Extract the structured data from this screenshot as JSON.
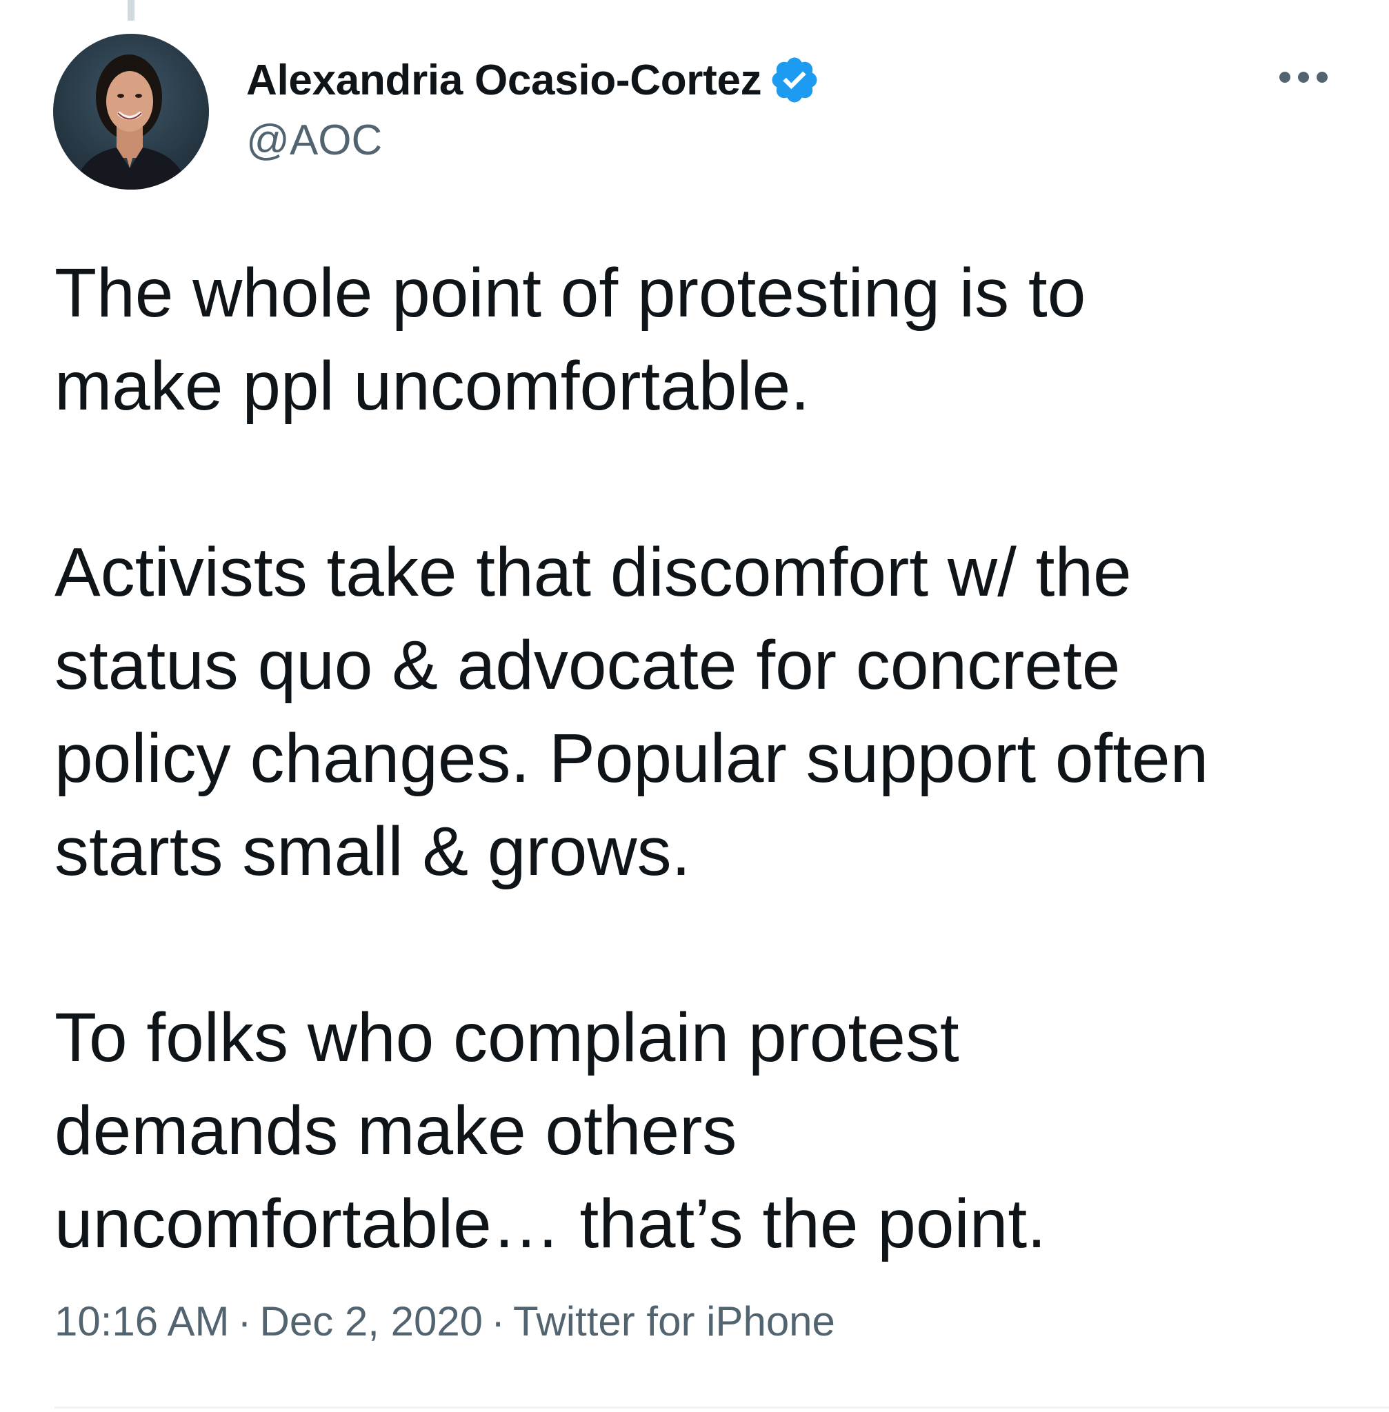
{
  "author": {
    "display_name": "Alexandria Ocasio-Cortez",
    "handle": "@AOC",
    "verified_icon": "verified-badge-icon",
    "verified_color": "#1d9bf0"
  },
  "tweet": {
    "paragraphs": [
      {
        "lines": [
          "The whole point of protesting is to",
          "make ppl uncomfortable."
        ]
      },
      {
        "lines": [
          "Activists take that discomfort w/ the",
          "status quo & advocate for concrete",
          "policy changes. Popular support often",
          "starts small & grows."
        ]
      },
      {
        "lines": [
          "To folks who complain protest",
          "demands make others",
          "uncomfortable… that’s the point."
        ]
      }
    ]
  },
  "meta": {
    "time": "10:16 AM",
    "date": "Dec 2, 2020",
    "source": "Twitter for iPhone",
    "separator": "·"
  },
  "icons": {
    "more": "more-horizontal-icon"
  },
  "colors": {
    "text_primary": "#0f1419",
    "text_secondary": "#536471",
    "accent": "#1d9bf0"
  }
}
